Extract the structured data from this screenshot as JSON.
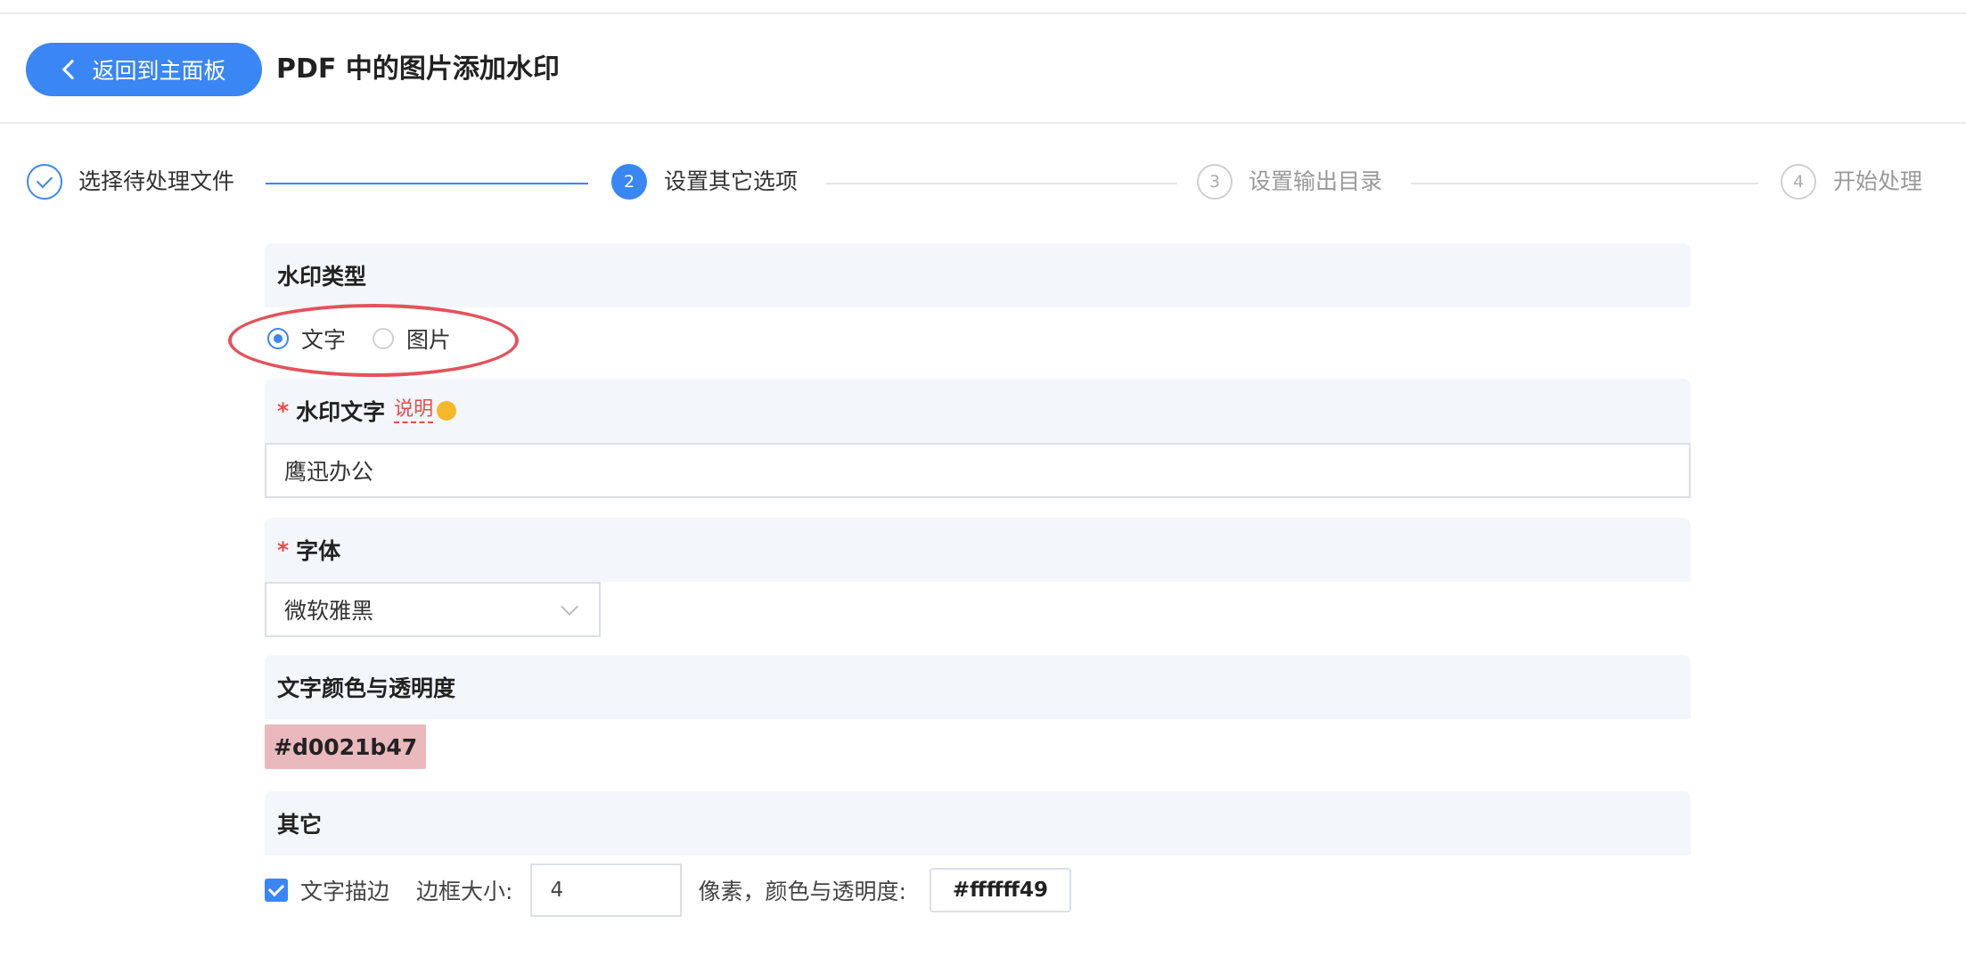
{
  "header": {
    "back_label": "返回到主面板",
    "title": "PDF 中的图片添加水印"
  },
  "steps": [
    {
      "number": "1",
      "label": "选择待处理文件",
      "state": "done"
    },
    {
      "number": "2",
      "label": "设置其它选项",
      "state": "active"
    },
    {
      "number": "3",
      "label": "设置输出目录",
      "state": "pending"
    },
    {
      "number": "4",
      "label": "开始处理",
      "state": "pending"
    }
  ],
  "watermark_type": {
    "label": "水印类型",
    "options": [
      "文字",
      "图片"
    ],
    "selected": "文字"
  },
  "watermark_text": {
    "required_mark": "*",
    "label": "水印文字",
    "help_label": "说明",
    "value": "鹰迅办公"
  },
  "font": {
    "required_mark": "*",
    "label": "字体",
    "selected": "微软雅黑"
  },
  "text_color": {
    "label": "文字颜色与透明度",
    "value": "#d0021b47"
  },
  "other": {
    "label": "其它",
    "stroke_checked": true,
    "stroke_label": "文字描边",
    "border_size_label": "边框大小:",
    "border_size_value": "4",
    "unit_color_label": "像素，颜色与透明度:",
    "stroke_color_value": "#ffffff49"
  },
  "colors": {
    "accent": "#3a86f5",
    "required": "#e84a4a",
    "annotation_circle": "#e4525b",
    "section_bg": "#f3f6fb",
    "swatch_bg": "#e9b9bd"
  }
}
